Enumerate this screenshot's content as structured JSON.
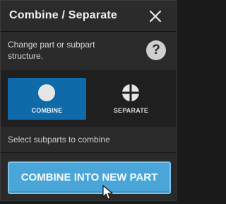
{
  "dialog": {
    "title": "Combine / Separate",
    "description": "Change part or subpart structure.",
    "close_icon": "close-icon",
    "help": {
      "label": "?",
      "icon": "help-icon"
    }
  },
  "modes": [
    {
      "label": "COMBINE",
      "icon": "circle-icon",
      "selected": true
    },
    {
      "label": "SEPARATE",
      "icon": "split-circle-icon",
      "selected": false
    }
  ],
  "instruction": "Select subparts to combine",
  "action": {
    "label": "COMBINE INTO NEW PART"
  },
  "colors": {
    "selected_mode": "#0e6aa8",
    "action_button": "#4aa6d8",
    "panel_background": "#2a2a2a"
  }
}
